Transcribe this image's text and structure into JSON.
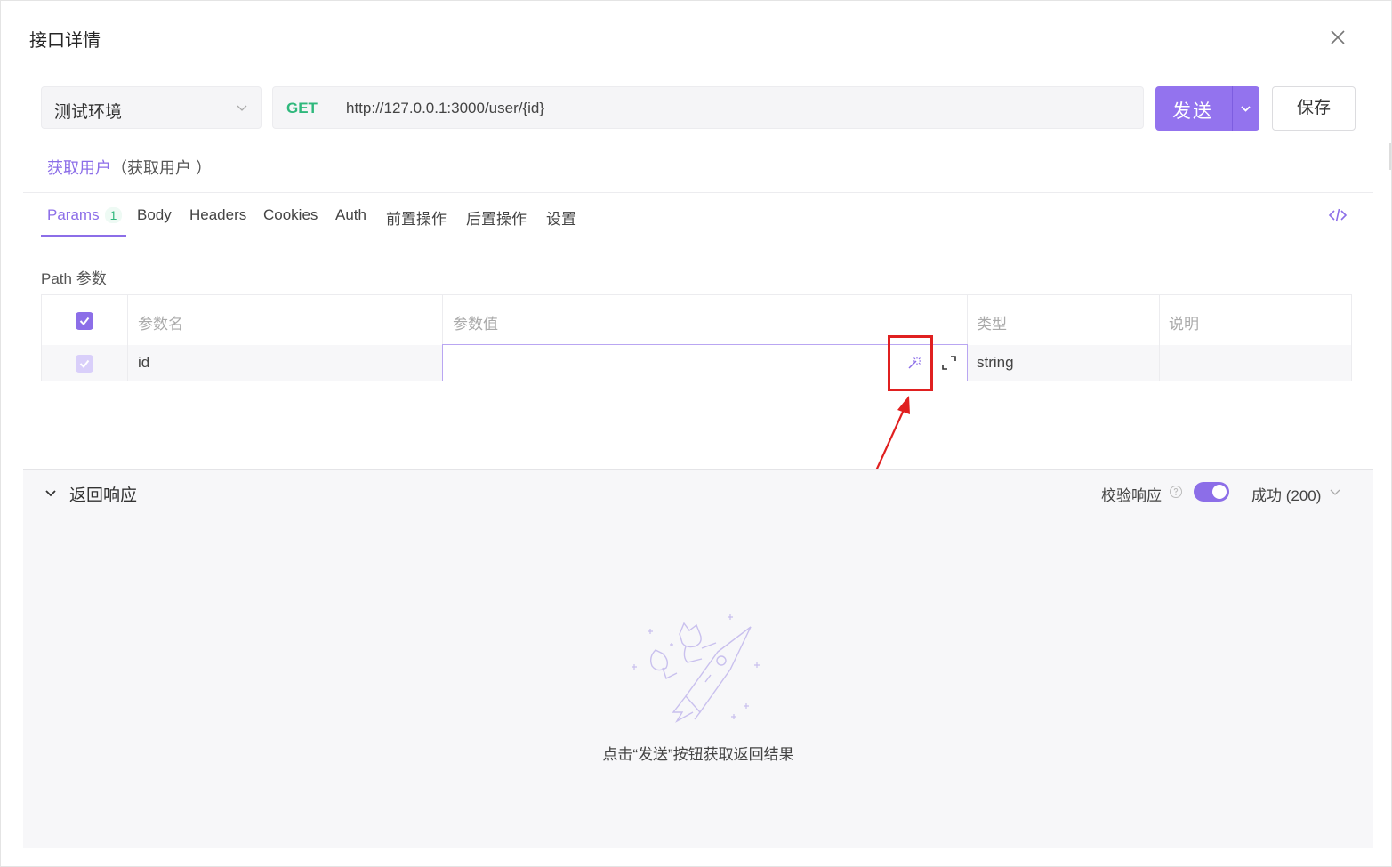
{
  "dialog": {
    "title": "接口详情"
  },
  "request": {
    "environment": "测试环境",
    "method": "GET",
    "url": "http://127.0.0.1:3000/user/{id}",
    "send_label": "发送",
    "save_label": "保存"
  },
  "api": {
    "name": "获取用户",
    "subtitle": "（获取用户 ）"
  },
  "tabs": [
    {
      "label": "Params",
      "count": "1"
    },
    {
      "label": "Body"
    },
    {
      "label": "Headers"
    },
    {
      "label": "Cookies"
    },
    {
      "label": "Auth"
    },
    {
      "label": "前置操作"
    },
    {
      "label": "后置操作"
    },
    {
      "label": "设置"
    }
  ],
  "params": {
    "section_label": "Path 参数",
    "columns": [
      "参数名",
      "参数值",
      "类型",
      "说明"
    ],
    "rows": [
      {
        "name": "id",
        "value": "",
        "type": "string",
        "description": ""
      }
    ]
  },
  "response": {
    "title": "返回响应",
    "verify_label": "校验响应",
    "status": "成功 (200)",
    "empty_text": "点击“发送”按钮获取返回结果"
  },
  "colors": {
    "accent": "#8c6ee8",
    "method_get": "#2fb87c",
    "annotation": "#e02020"
  }
}
